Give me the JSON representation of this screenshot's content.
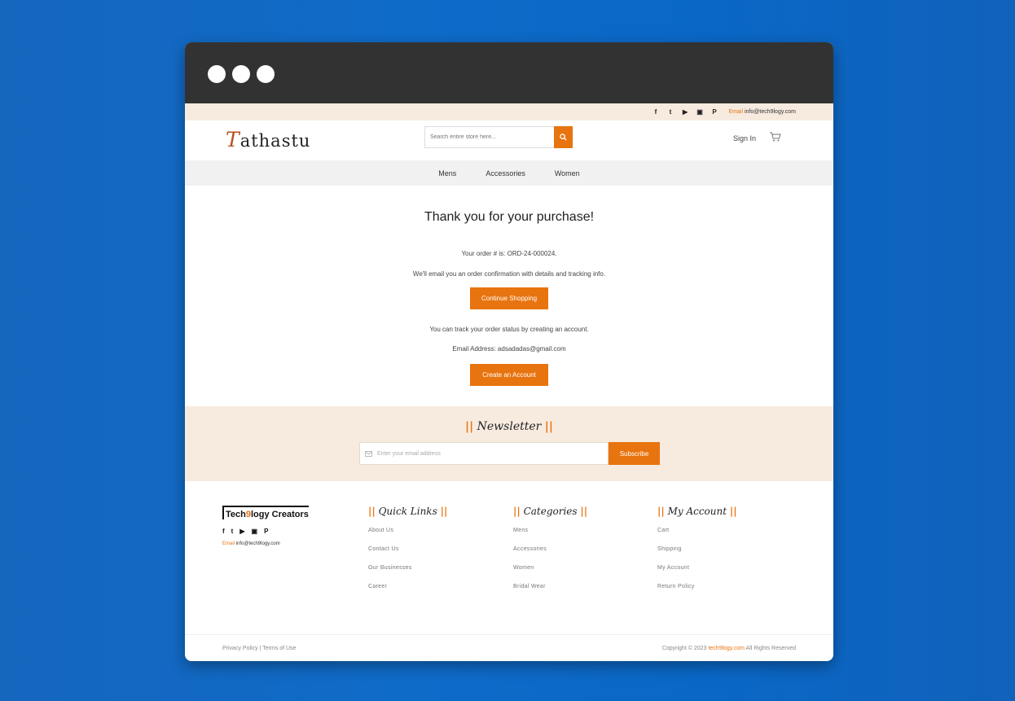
{
  "topbar": {
    "social": [
      {
        "name": "facebook-icon",
        "glyph": "f"
      },
      {
        "name": "twitter-icon",
        "glyph": "🐦"
      },
      {
        "name": "youtube-icon",
        "glyph": "▶"
      },
      {
        "name": "instagram-icon",
        "glyph": "▣"
      },
      {
        "name": "pinterest-icon",
        "glyph": "P"
      }
    ],
    "email_label": "Email",
    "email_value": "info@tech9logy.com"
  },
  "header": {
    "logo_cap": "T",
    "logo_rest": "athastu",
    "search_placeholder": "Search entire store here...",
    "search_icon": "search-icon",
    "signin_label": "Sign In",
    "cart_icon": "cart-icon"
  },
  "nav": {
    "items": [
      "Mens",
      "Accessories",
      "Women"
    ]
  },
  "confirmation": {
    "title": "Thank you for your purchase!",
    "order_line": "Your order # is: ORD-24-000024.",
    "email_line": "We'll email you an order confirmation with details and tracking info.",
    "continue_label": "Continue Shopping",
    "track_line": "You can track your order status by creating an account.",
    "address_line": "Email Address: adsadadas@gmail.com",
    "create_label": "Create an Account"
  },
  "newsletter": {
    "title": "Newsletter",
    "placeholder": "Enter your email address",
    "subscribe_label": "Subscribe"
  },
  "footer": {
    "brand_prefix": "Tech",
    "brand_nine": "9",
    "brand_suffix": "logy Creators",
    "email_label": "Email",
    "email_value": "info@tech9logy.com",
    "columns": [
      {
        "title": "Quick Links",
        "links": [
          "About Us",
          "Contact Us",
          "Our Businesses",
          "Career"
        ]
      },
      {
        "title": "Categories",
        "links": [
          "Mens",
          "Accessories",
          "Women",
          "Bridal Wear"
        ]
      },
      {
        "title": "My Account",
        "links": [
          "Cart",
          "Shipping",
          "My Account",
          "Return Policy"
        ]
      }
    ]
  },
  "bottom": {
    "privacy": "Privacy Policy",
    "separator": "|",
    "terms": "Terms of Use",
    "copyright_prefix": "Copyright © 2023",
    "copyright_site": "tech9logy.com",
    "copyright_suffix": "All Rights Reserved"
  },
  "colors": {
    "accent": "#e8740f",
    "titlebar": "#333232",
    "cream": "#f7ebe0",
    "background": "#0f6bc8"
  }
}
